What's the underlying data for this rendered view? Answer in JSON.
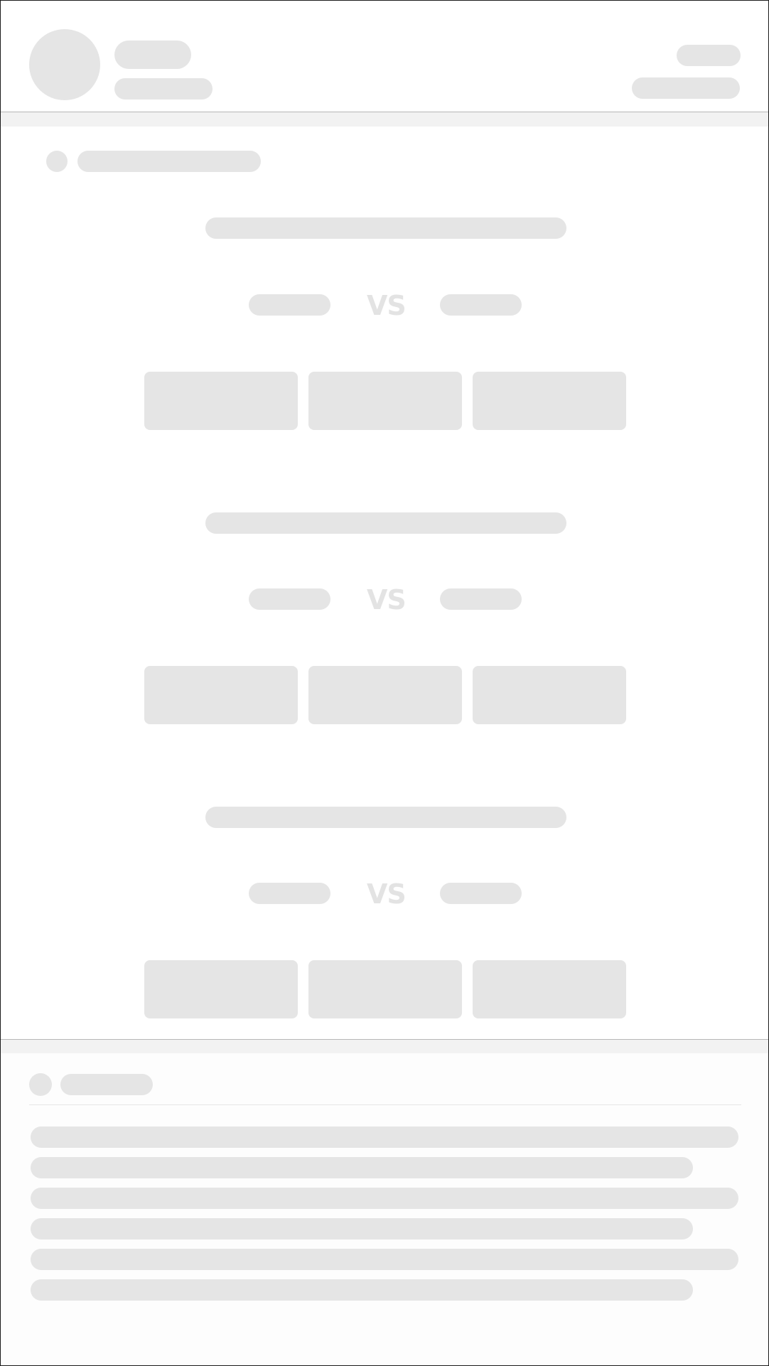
{
  "matches": [
    {
      "vs_text": "VS"
    },
    {
      "vs_text": "VS"
    },
    {
      "vs_text": "VS"
    }
  ]
}
